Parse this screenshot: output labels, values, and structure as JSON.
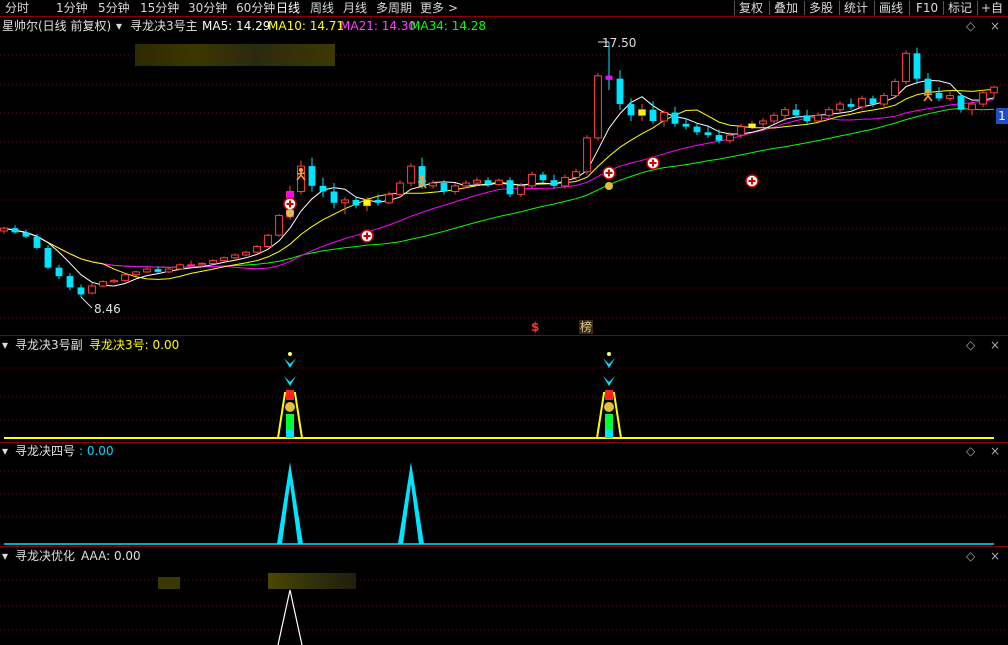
{
  "toolbar": {
    "periods": [
      "分时",
      "1分钟",
      "5分钟",
      "15分钟",
      "30分钟",
      "60分钟",
      "日线",
      "周线",
      "月线",
      "多周期",
      "更多"
    ],
    "more_arrow": ">",
    "active_period": "日线",
    "right_buttons": [
      "复权",
      "叠加",
      "多股",
      "统计",
      "画线",
      "F10",
      "标记",
      "+自"
    ]
  },
  "main_panel": {
    "stock_title": "星帅尔(日线 前复权)",
    "indicator_name": "寻龙决3号主",
    "ma": [
      {
        "label": "MA5: 14.29",
        "color": "#ffffff"
      },
      {
        "label": "MA10: 14.71",
        "color": "#ffff00"
      },
      {
        "label": "MA21: 14.30",
        "color": "#ff00ff"
      },
      {
        "label": "MA34: 14.28",
        "color": "#00ff00"
      }
    ],
    "high_label": "17.50",
    "low_label": "8.46",
    "marker_s": "$",
    "marker_bang": "榜",
    "right_badge": "1"
  },
  "sub_panels": [
    {
      "name": "寻龙决3号副",
      "value_label": "寻龙决3号: 0.00",
      "value_color": "#ffff00"
    },
    {
      "name": "寻龙决四号",
      "value_label": ": 0.00",
      "value_color": "#00d8ff"
    },
    {
      "name": "寻龙决优化",
      "value_label": "AAA: 0.00",
      "value_color": "#ffffff"
    }
  ],
  "chart_data": {
    "type": "candlestick",
    "title": "星帅尔(日线 前复权)",
    "y_marks": {
      "high": 17.5,
      "low": 8.46
    },
    "ma_values": {
      "MA5": 14.29,
      "MA10": 14.71,
      "MA21": 14.3,
      "MA34": 14.28
    },
    "colors": {
      "up": "#ff4040",
      "down": "#00e5ff",
      "ma5": "#ffffff",
      "ma10": "#ffff00",
      "ma21": "#ff00ff",
      "ma34": "#00ff00"
    },
    "candles": [
      [
        10.8,
        10.95,
        10.7,
        10.9
      ],
      [
        10.9,
        11.0,
        10.7,
        10.75
      ],
      [
        10.75,
        10.85,
        10.55,
        10.6
      ],
      [
        10.6,
        10.7,
        10.15,
        10.2
      ],
      [
        10.2,
        10.3,
        9.45,
        9.5
      ],
      [
        9.5,
        9.6,
        9.1,
        9.2
      ],
      [
        9.2,
        9.3,
        8.7,
        8.8
      ],
      [
        8.8,
        8.9,
        8.46,
        8.55
      ],
      [
        8.6,
        8.95,
        8.55,
        8.85
      ],
      [
        8.85,
        9.05,
        8.8,
        9.0
      ],
      [
        9.0,
        9.1,
        8.95,
        9.05
      ],
      [
        9.05,
        9.3,
        9.0,
        9.25
      ],
      [
        9.25,
        9.4,
        9.2,
        9.35
      ],
      [
        9.35,
        9.5,
        9.3,
        9.45
      ],
      [
        9.45,
        9.55,
        9.3,
        9.35
      ],
      [
        9.35,
        9.5,
        9.3,
        9.45
      ],
      [
        9.45,
        9.65,
        9.45,
        9.6
      ],
      [
        9.6,
        9.75,
        9.55,
        9.6
      ],
      [
        9.6,
        9.7,
        9.5,
        9.65
      ],
      [
        9.65,
        9.8,
        9.6,
        9.75
      ],
      [
        9.75,
        9.9,
        9.7,
        9.85
      ],
      [
        9.85,
        10.0,
        9.75,
        9.95
      ],
      [
        9.95,
        10.1,
        9.9,
        10.05
      ],
      [
        10.05,
        10.3,
        10.0,
        10.25
      ],
      [
        10.25,
        10.7,
        10.2,
        10.65
      ],
      [
        10.65,
        11.4,
        10.6,
        11.35
      ],
      [
        11.3,
        12.4,
        11.2,
        12.2
      ],
      [
        12.2,
        13.3,
        12.1,
        13.1
      ],
      [
        13.1,
        13.4,
        12.2,
        12.4
      ],
      [
        12.4,
        12.7,
        12.0,
        12.2
      ],
      [
        12.2,
        12.5,
        11.6,
        11.8
      ],
      [
        11.8,
        12.0,
        11.4,
        11.9
      ],
      [
        11.9,
        12.0,
        11.6,
        11.7
      ],
      [
        11.7,
        12.0,
        11.5,
        11.9
      ],
      [
        11.9,
        12.1,
        11.7,
        11.8
      ],
      [
        11.8,
        12.2,
        11.75,
        12.1
      ],
      [
        12.1,
        12.6,
        12.0,
        12.5
      ],
      [
        12.5,
        13.2,
        12.4,
        13.1
      ],
      [
        13.1,
        13.4,
        12.3,
        12.4
      ],
      [
        12.4,
        12.6,
        12.3,
        12.5
      ],
      [
        12.5,
        12.6,
        12.1,
        12.2
      ],
      [
        12.2,
        12.5,
        12.1,
        12.4
      ],
      [
        12.4,
        12.6,
        12.3,
        12.5
      ],
      [
        12.5,
        12.7,
        12.4,
        12.6
      ],
      [
        12.6,
        12.7,
        12.35,
        12.45
      ],
      [
        12.45,
        12.65,
        12.4,
        12.6
      ],
      [
        12.6,
        12.7,
        12.0,
        12.1
      ],
      [
        12.1,
        12.5,
        12.0,
        12.4
      ],
      [
        12.4,
        12.9,
        12.3,
        12.8
      ],
      [
        12.8,
        12.9,
        12.5,
        12.6
      ],
      [
        12.6,
        12.8,
        12.3,
        12.4
      ],
      [
        12.4,
        12.8,
        12.3,
        12.7
      ],
      [
        12.7,
        13.0,
        12.6,
        12.9
      ],
      [
        12.9,
        14.2,
        12.8,
        14.1
      ],
      [
        14.1,
        16.4,
        14.0,
        16.3
      ],
      [
        16.3,
        17.5,
        15.8,
        16.2
      ],
      [
        16.2,
        16.5,
        15.1,
        15.3
      ],
      [
        15.3,
        15.5,
        14.7,
        14.9
      ],
      [
        14.9,
        15.3,
        14.7,
        15.1
      ],
      [
        15.1,
        15.4,
        14.6,
        14.7
      ],
      [
        14.7,
        15.1,
        14.5,
        15.0
      ],
      [
        15.0,
        15.2,
        14.5,
        14.6
      ],
      [
        14.6,
        14.8,
        14.4,
        14.5
      ],
      [
        14.5,
        14.6,
        14.2,
        14.3
      ],
      [
        14.3,
        14.5,
        14.1,
        14.2
      ],
      [
        14.2,
        14.4,
        13.9,
        14.0
      ],
      [
        14.0,
        14.3,
        13.9,
        14.2
      ],
      [
        14.2,
        14.6,
        14.1,
        14.5
      ],
      [
        14.5,
        14.7,
        14.4,
        14.6
      ],
      [
        14.6,
        14.8,
        14.5,
        14.7
      ],
      [
        14.7,
        15.0,
        14.6,
        14.9
      ],
      [
        14.9,
        15.2,
        14.7,
        15.1
      ],
      [
        15.1,
        15.3,
        14.8,
        14.9
      ],
      [
        14.9,
        15.1,
        14.6,
        14.7
      ],
      [
        14.7,
        15.0,
        14.6,
        14.9
      ],
      [
        14.9,
        15.2,
        14.8,
        15.1
      ],
      [
        15.1,
        15.4,
        15.0,
        15.3
      ],
      [
        15.3,
        15.5,
        15.1,
        15.2
      ],
      [
        15.2,
        15.6,
        15.1,
        15.5
      ],
      [
        15.5,
        15.6,
        15.2,
        15.3
      ],
      [
        15.3,
        15.7,
        15.2,
        15.6
      ],
      [
        15.6,
        16.2,
        15.5,
        16.1
      ],
      [
        16.1,
        17.2,
        16.0,
        17.1
      ],
      [
        17.1,
        17.3,
        16.0,
        16.2
      ],
      [
        16.2,
        16.4,
        15.6,
        15.7
      ],
      [
        15.7,
        15.9,
        15.4,
        15.5
      ],
      [
        15.5,
        15.8,
        15.4,
        15.6
      ],
      [
        15.6,
        15.7,
        15.0,
        15.1
      ],
      [
        15.1,
        15.4,
        14.9,
        15.3
      ],
      [
        15.3,
        15.8,
        15.2,
        15.7
      ],
      [
        15.7,
        15.95,
        15.5,
        15.9
      ]
    ]
  }
}
